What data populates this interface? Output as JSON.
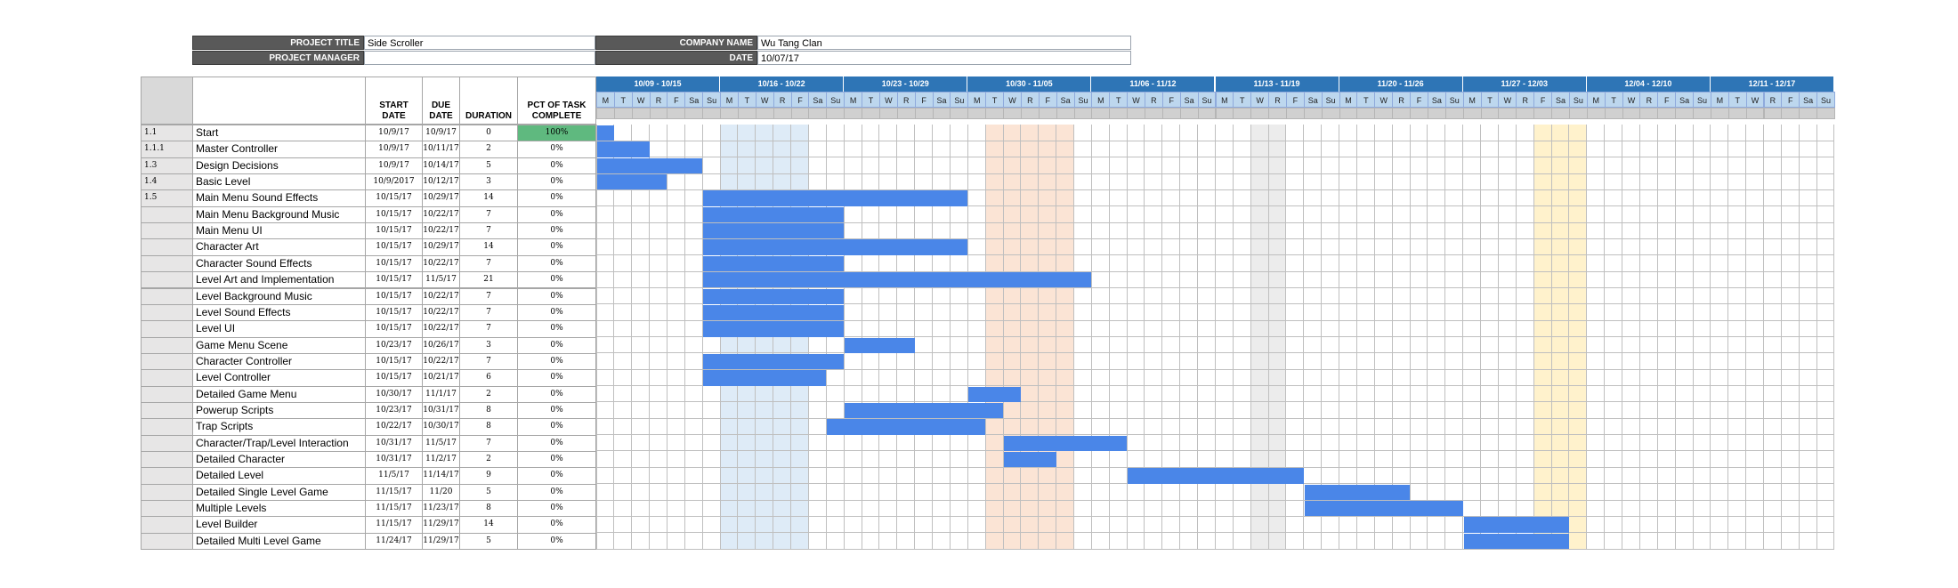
{
  "header": {
    "project_title_label": "PROJECT TITLE",
    "project_title": "Side Scroller",
    "project_manager_label": "PROJECT MANAGER",
    "project_manager": "",
    "company_name_label": "COMPANY NAME",
    "company_name": "Wu Tang Clan",
    "date_label": "DATE",
    "date": "10/07/17"
  },
  "columns": {
    "start": "START DATE",
    "due": "DUE DATE",
    "duration": "DURATION",
    "pct": "PCT OF TASK COMPLETE"
  },
  "weeks": [
    "10/09 - 10/15",
    "10/16 - 10/22",
    "10/23 - 10/29",
    "10/30 - 11/05",
    "11/06 - 11/12",
    "11/13 - 11/19",
    "11/20 - 11/26",
    "11/27 - 12/03",
    "12/04 - 12/10",
    "12/11 - 12/17"
  ],
  "day_letters": [
    "M",
    "T",
    "W",
    "R",
    "F",
    "Sa",
    "Su"
  ],
  "colors": {
    "bar": "#4a86e8",
    "week_header": "#2e75b6",
    "day_header": "#bdd7ee",
    "complete": "#5fb97f",
    "highlight_blue": "#deebf7",
    "highlight_orange": "#fbe4d5",
    "highlight_yellow": "#fff2cc",
    "weekend_gray": "#ededed"
  },
  "highlights": [
    {
      "start": 7,
      "end": 11,
      "color": "#deebf7"
    },
    {
      "start": 22,
      "end": 26,
      "color": "#fbe4d5"
    },
    {
      "start": 53,
      "end": 55,
      "color": "#fff2cc"
    },
    {
      "start": 37,
      "end": 38,
      "color": "#ececec"
    }
  ],
  "tasks": [
    {
      "id": "1.1",
      "name": "Start",
      "start": "10/9/17",
      "due": "10/9/17",
      "duration": "0",
      "pct": "100%",
      "bar_start": 0,
      "bar_days": 1,
      "complete": true
    },
    {
      "id": "1.1.1",
      "name": "Master Controller",
      "start": "10/9/17",
      "due": "10/11/17",
      "duration": "2",
      "pct": "0%",
      "bar_start": 0,
      "bar_days": 3
    },
    {
      "id": "1.3",
      "name": "Design Decisions",
      "start": "10/9/17",
      "due": "10/14/17",
      "duration": "5",
      "pct": "0%",
      "bar_start": 0,
      "bar_days": 6
    },
    {
      "id": "1.4",
      "name": "Basic Level",
      "start": "10/9/2017",
      "due": "10/12/17",
      "duration": "3",
      "pct": "0%",
      "bar_start": 0,
      "bar_days": 4
    },
    {
      "id": "1.5",
      "name": "Main Menu Sound Effects",
      "start": "10/15/17",
      "due": "10/29/17",
      "duration": "14",
      "pct": "0%",
      "bar_start": 6,
      "bar_days": 15
    },
    {
      "id": "",
      "name": "Main Menu Background Music",
      "start": "10/15/17",
      "due": "10/22/17",
      "duration": "7",
      "pct": "0%",
      "bar_start": 6,
      "bar_days": 8
    },
    {
      "id": "",
      "name": "Main Menu UI",
      "start": "10/15/17",
      "due": "10/22/17",
      "duration": "7",
      "pct": "0%",
      "bar_start": 6,
      "bar_days": 8
    },
    {
      "id": "",
      "name": "Character Art",
      "start": "10/15/17",
      "due": "10/29/17",
      "duration": "14",
      "pct": "0%",
      "bar_start": 6,
      "bar_days": 15
    },
    {
      "id": "",
      "name": "Character Sound Effects",
      "start": "10/15/17",
      "due": "10/22/17",
      "duration": "7",
      "pct": "0%",
      "bar_start": 6,
      "bar_days": 8
    },
    {
      "id": "",
      "name": "Level Art and Implementation",
      "start": "10/15/17",
      "due": "11/5/17",
      "duration": "21",
      "pct": "0%",
      "bar_start": 6,
      "bar_days": 22
    },
    {
      "id": "",
      "name": "Level Background Music",
      "start": "10/15/17",
      "due": "10/22/17",
      "duration": "7",
      "pct": "0%",
      "bar_start": 6,
      "bar_days": 8
    },
    {
      "id": "",
      "name": "Level Sound Effects",
      "start": "10/15/17",
      "due": "10/22/17",
      "duration": "7",
      "pct": "0%",
      "bar_start": 6,
      "bar_days": 8
    },
    {
      "id": "",
      "name": "Level UI",
      "start": "10/15/17",
      "due": "10/22/17",
      "duration": "7",
      "pct": "0%",
      "bar_start": 6,
      "bar_days": 8
    },
    {
      "id": "",
      "name": "Game Menu Scene",
      "start": "10/23/17",
      "due": "10/26/17",
      "duration": "3",
      "pct": "0%",
      "bar_start": 14,
      "bar_days": 4
    },
    {
      "id": "",
      "name": "Character Controller",
      "start": "10/15/17",
      "due": "10/22/17",
      "duration": "7",
      "pct": "0%",
      "bar_start": 6,
      "bar_days": 8
    },
    {
      "id": "",
      "name": "Level Controller",
      "start": "10/15/17",
      "due": "10/21/17",
      "duration": "6",
      "pct": "0%",
      "bar_start": 6,
      "bar_days": 7
    },
    {
      "id": "",
      "name": "Detailed Game Menu",
      "start": "10/30/17",
      "due": "11/1/17",
      "duration": "2",
      "pct": "0%",
      "bar_start": 21,
      "bar_days": 3
    },
    {
      "id": "",
      "name": "Powerup Scripts",
      "start": "10/23/17",
      "due": "10/31/17",
      "duration": "8",
      "pct": "0%",
      "bar_start": 14,
      "bar_days": 9
    },
    {
      "id": "",
      "name": "Trap Scripts",
      "start": "10/22/17",
      "due": "10/30/17",
      "duration": "8",
      "pct": "0%",
      "bar_start": 13,
      "bar_days": 9
    },
    {
      "id": "",
      "name": "Character/Trap/Level Interaction",
      "start": "10/31/17",
      "due": "11/5/17",
      "duration": "7",
      "pct": "0%",
      "bar_start": 23,
      "bar_days": 7
    },
    {
      "id": "",
      "name": "Detailed Character",
      "start": "10/31/17",
      "due": "11/2/17",
      "duration": "2",
      "pct": "0%",
      "bar_start": 23,
      "bar_days": 3
    },
    {
      "id": "",
      "name": "Detailed Level",
      "start": "11/5/17",
      "due": "11/14/17",
      "duration": "9",
      "pct": "0%",
      "bar_start": 30,
      "bar_days": 10
    },
    {
      "id": "",
      "name": "Detailed Single Level Game",
      "start": "11/15/17",
      "due": "11/20",
      "duration": "5",
      "pct": "0%",
      "bar_start": 40,
      "bar_days": 6
    },
    {
      "id": "",
      "name": "Multiple Levels",
      "start": "11/15/17",
      "due": "11/23/17",
      "duration": "8",
      "pct": "0%",
      "bar_start": 40,
      "bar_days": 9
    },
    {
      "id": "",
      "name": "Level Builder",
      "start": "11/15/17",
      "due": "11/29/17",
      "duration": "14",
      "pct": "0%",
      "bar_start": 49,
      "bar_days": 6
    },
    {
      "id": "",
      "name": "Detailed Multi Level Game",
      "start": "11/24/17",
      "due": "11/29/17",
      "duration": "5",
      "pct": "0%",
      "bar_start": 49,
      "bar_days": 6
    }
  ]
}
